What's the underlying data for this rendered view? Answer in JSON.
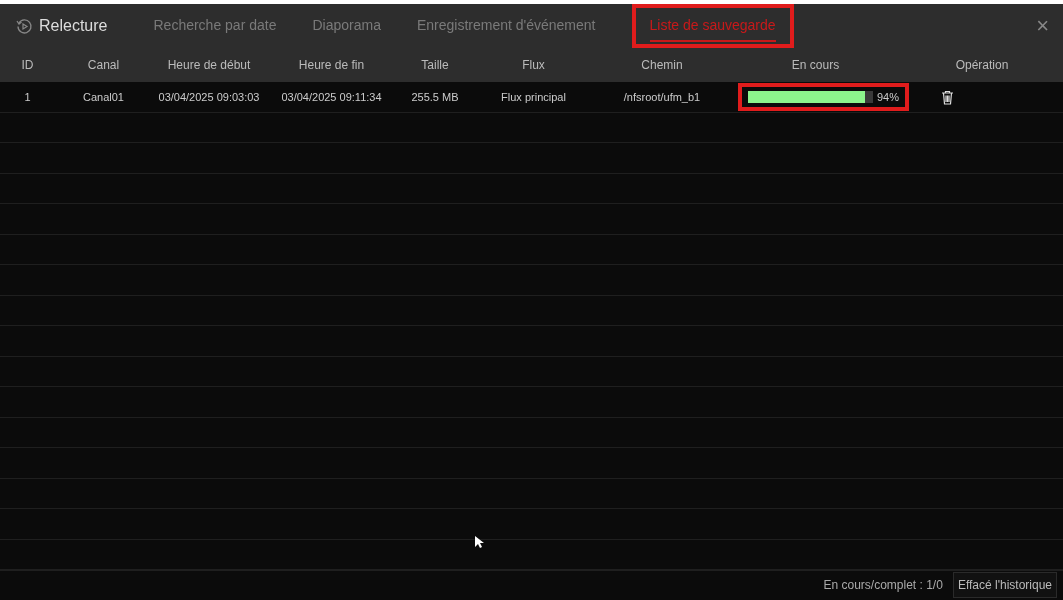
{
  "window": {
    "title": "Relecture",
    "close": "×"
  },
  "tabs": [
    {
      "label": "Recherche par date",
      "selected": false,
      "highlighted": false
    },
    {
      "label": "Diaporama",
      "selected": false,
      "highlighted": false
    },
    {
      "label": "Enregistrement d'événement",
      "selected": false,
      "highlighted": false
    },
    {
      "label": "Liste de sauvegarde",
      "selected": true,
      "highlighted": true
    }
  ],
  "table": {
    "columns": [
      "ID",
      "Canal",
      "Heure de début",
      "Heure de fin",
      "Taille",
      "Flux",
      "Chemin",
      "En cours",
      "Opération"
    ],
    "rows": [
      {
        "id": "1",
        "canal": "Canal01",
        "start": "03/04/2025 09:03:03",
        "end": "03/04/2025 09:11:34",
        "size": "255.5 MB",
        "flux": "Flux principal",
        "path": "/nfsroot/ufm_b1",
        "level": 0.94,
        "reading": "94%",
        "highlighted": true
      }
    ]
  },
  "status_bar": {
    "summary": "En cours/complet : 1/0",
    "clear_button": "Effacé l'historique"
  }
}
